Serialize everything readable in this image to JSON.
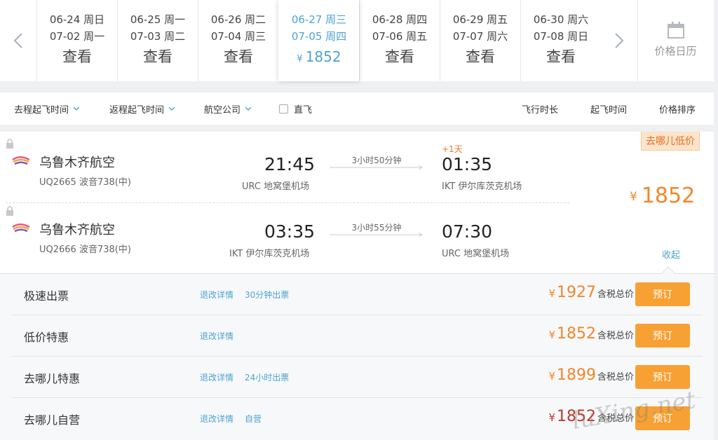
{
  "date_bar": {
    "dates": [
      {
        "out": "06-24 周日",
        "ret": "07-02 周一",
        "label": "查看"
      },
      {
        "out": "06-25 周一",
        "ret": "07-03 周二",
        "label": "查看"
      },
      {
        "out": "06-26 周二",
        "ret": "07-04 周三",
        "label": "查看"
      },
      {
        "out": "06-27 周三",
        "ret": "07-05 周四",
        "label": "1852",
        "currency": "¥"
      },
      {
        "out": "06-28 周四",
        "ret": "07-06 周五",
        "label": "查看"
      },
      {
        "out": "06-29 周五",
        "ret": "07-07 周六",
        "label": "查看"
      },
      {
        "out": "06-30 周六",
        "ret": "07-08 周日",
        "label": "查看"
      }
    ],
    "calendar_label": "价格日历",
    "left_arrow_icon": "chevron-left-icon",
    "right_arrow_icon": "chevron-right-icon"
  },
  "filters": {
    "outbound_time": "去程起飞时间",
    "return_time": "返程起飞时间",
    "airline": "航空公司",
    "direct": "直飞",
    "direct_checked": false,
    "sort_duration": "飞行时长",
    "sort_departure": "起飞时间",
    "sort_price": "价格排序"
  },
  "flight": {
    "badge": "去哪儿低价",
    "price_currency": "¥",
    "price": "1852",
    "collapse": "收起",
    "legs": [
      {
        "airline": "乌鲁木齐航空",
        "flight_no": "UQ2665 波音738(中)",
        "dep_time": "21:45",
        "dep_airport": "URC 地窝堡机场",
        "duration": "3小时50分钟",
        "arr_time": "01:35",
        "arr_airport": "IKT 伊尔库茨克机场",
        "day_offset": "+1天"
      },
      {
        "airline": "乌鲁木齐航空",
        "flight_no": "UQ2666 波音738(中)",
        "dep_time": "03:35",
        "dep_airport": "IKT 伊尔库茨克机场",
        "duration": "3小时55分钟",
        "arr_time": "07:30",
        "arr_airport": "URC 地窝堡机场",
        "day_offset": ""
      }
    ]
  },
  "options": [
    {
      "name": "极速出票",
      "link1": "退改详情",
      "link2": "30分钟出票",
      "currency": "¥",
      "price": "1927",
      "tax": "含税总价",
      "button": "预订"
    },
    {
      "name": "低价特惠",
      "link1": "退改详情",
      "link2": "",
      "currency": "¥",
      "price": "1852",
      "tax": "含税总价",
      "button": "预订"
    },
    {
      "name": "去哪儿特惠",
      "link1": "退改详情",
      "link2": "24小时出票",
      "currency": "¥",
      "price": "1899",
      "tax": "含税总价",
      "button": "预订"
    },
    {
      "name": "去哪儿自营",
      "link1": "退改详情",
      "link2": "自营",
      "currency": "¥",
      "price": "1852",
      "tax": "含税总价",
      "button": "预订"
    }
  ],
  "colors": {
    "accent_blue": "#4ea3d2",
    "price_orange": "#f3862b",
    "button_orange": "#f7a135",
    "price_red": "#c0392b"
  },
  "watermark": "luXing.net"
}
